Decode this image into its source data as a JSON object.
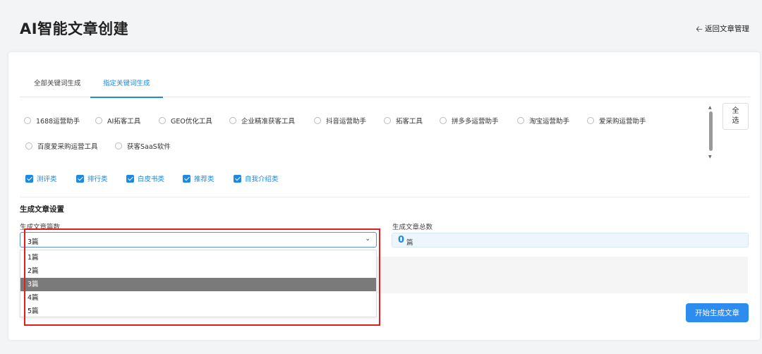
{
  "header": {
    "title": "AI智能文章创建",
    "back_icon": "arrow-left-icon",
    "back_label": "返回文章管理"
  },
  "tabs": [
    {
      "label": "全部关键词生成",
      "active": false
    },
    {
      "label": "指定关键词生成",
      "active": true
    }
  ],
  "keywords": [
    "1688运营助手",
    "AI拓客工具",
    "GEO优化工具",
    "企业精准获客工具",
    "抖音运营助手",
    "拓客工具",
    "拼多多运营助手",
    "淘宝运营助手",
    "爱采购运营助手",
    "百度爱采购运营工具",
    "获客SaaS软件"
  ],
  "select_all": {
    "line1": "全",
    "line2": "选"
  },
  "categories": [
    {
      "label": "测评类",
      "checked": true
    },
    {
      "label": "排行类",
      "checked": true
    },
    {
      "label": "白皮书类",
      "checked": true
    },
    {
      "label": "推荐类",
      "checked": true
    },
    {
      "label": "自我介绍类",
      "checked": true
    }
  ],
  "settings": {
    "section_title": "生成文章设置",
    "count_label": "生成文章篇数",
    "count_value": "3篇",
    "count_options": [
      "1篇",
      "2篇",
      "3篇",
      "4篇",
      "5篇"
    ],
    "selected_index": 2,
    "total_label": "生成文章总数",
    "total_value": "0",
    "total_unit": "篇"
  },
  "actions": {
    "generate_label": "开始生成文章"
  },
  "colors": {
    "accent": "#1e88e5",
    "highlight": "#e01e1e",
    "button": "#2d8cf0"
  }
}
